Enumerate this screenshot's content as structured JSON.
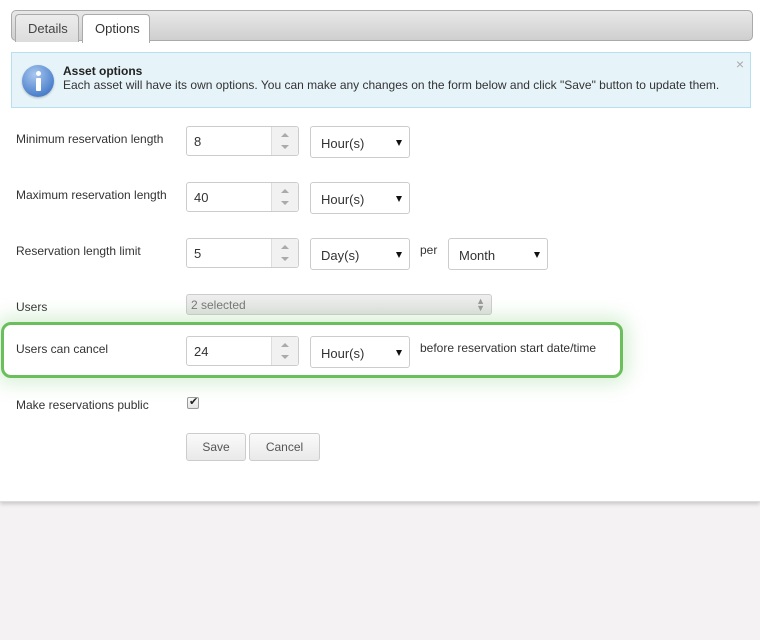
{
  "tabs": [
    {
      "label": "Details",
      "active": false
    },
    {
      "label": "Options",
      "active": true
    }
  ],
  "alert": {
    "icon": "info-icon",
    "title": "Asset options",
    "text": "Each asset will have its own options. You can make any changes on the form below and click \"Save\" button to update them.",
    "close_glyph": "×",
    "background_color": "#e6f4fa"
  },
  "form": {
    "min_length": {
      "label": "Minimum reservation length",
      "value": "8",
      "unit": "Hour(s)"
    },
    "max_length": {
      "label": "Maximum reservation length",
      "value": "40",
      "unit": "Hour(s)"
    },
    "length_limit": {
      "label": "Reservation length limit",
      "value": "5",
      "unit": "Day(s)",
      "per_label": "per",
      "period": "Month"
    },
    "users": {
      "label": "Users",
      "value": "2 selected",
      "arrows_glyph": "⬍"
    },
    "cancel": {
      "label": "Users can cancel",
      "value": "24",
      "unit": "Hour(s)",
      "suffix": "before reservation start date/time",
      "highlight_color": "#6abf5c"
    },
    "public": {
      "label": "Make reservations public",
      "checked": true,
      "check_glyph": "✔"
    }
  },
  "buttons": {
    "save_label": "Save",
    "cancel_label": "Cancel"
  }
}
